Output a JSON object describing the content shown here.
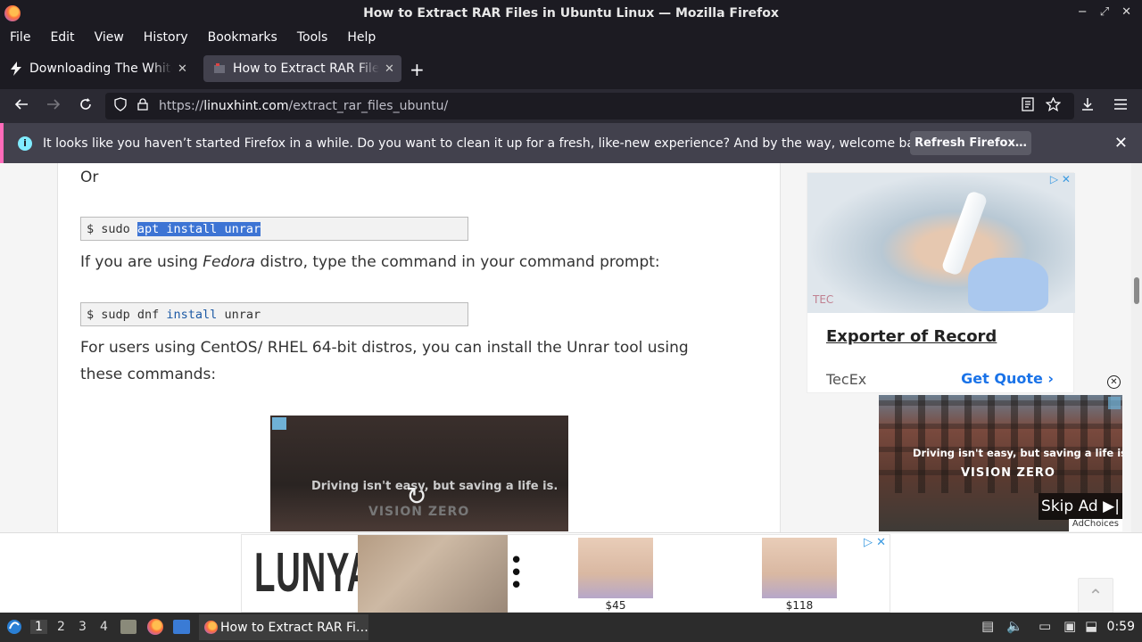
{
  "window": {
    "title": "How to Extract RAR Files in Ubuntu Linux — Mozilla Firefox"
  },
  "menu": [
    "File",
    "Edit",
    "View",
    "History",
    "Bookmarks",
    "Tools",
    "Help"
  ],
  "tabs": [
    {
      "label": "Downloading The White House",
      "active": false
    },
    {
      "label": "How to Extract RAR Files in Ubuntu",
      "active": true
    }
  ],
  "url": {
    "prefix": "https://",
    "host": "linuxhint.com",
    "path": "/extract_rar_files_ubuntu/"
  },
  "notification": {
    "text": "It looks like you haven’t started Firefox in a while. Do you want to clean it up for a fresh, like-new experience? And by the way, welcome back!",
    "button": "Refresh Firefox…"
  },
  "article": {
    "or_text": "Or",
    "code1": {
      "prompt": "$ sudo ",
      "selected": "apt install unrar"
    },
    "fedora_pre": "If you are using ",
    "fedora_em": "Fedora",
    "fedora_post": " distro, type the command in your command prompt:",
    "code2": {
      "prompt": "$ sudp dnf ",
      "kw": "install",
      "rest": " unrar"
    },
    "centos_line1": "For users using CentOS/ RHEL 64-bit distros, you can install the Unrar tool using",
    "centos_line2": "these commands:"
  },
  "video_ad": {
    "text": "Driving isn't easy, but saving a life is.",
    "brand": "VISION ZERO"
  },
  "side_ad": {
    "title": "Exporter of Record",
    "brand": "TecEx",
    "cta": "Get Quote",
    "logo_text": "TEC"
  },
  "float_ad": {
    "text": "Driving isn't easy, but saving a life is.",
    "brand": "VISION ZERO",
    "skip": "Skip Ad",
    "adchoices": "AdChoices"
  },
  "bottom_ad": {
    "logo": "LUNYA",
    "prices": [
      "$45",
      "$118"
    ]
  },
  "taskbar": {
    "workspaces": [
      "1",
      "2",
      "3",
      "4"
    ],
    "app_label": "How to Extract RAR Fi…",
    "clock": "0:59"
  },
  "colors": {
    "accent": "#3d74d4",
    "link": "#1a73e8",
    "notif_border": "#ff6bba"
  }
}
